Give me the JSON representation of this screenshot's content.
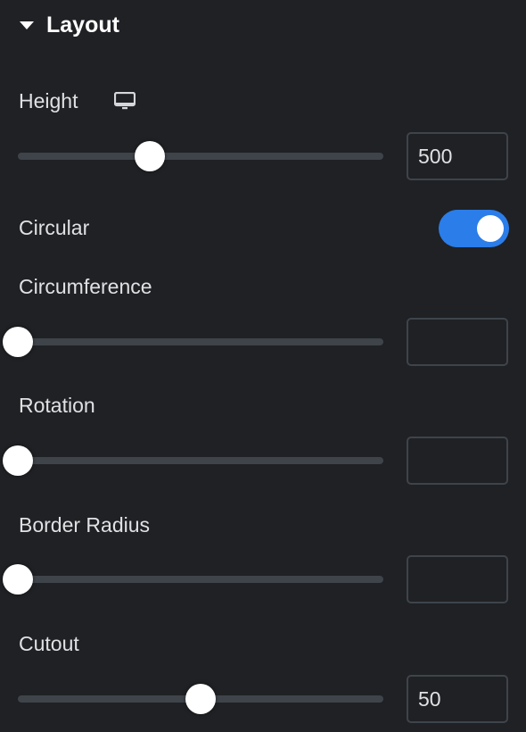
{
  "section": {
    "title": "Layout",
    "expanded": true
  },
  "controls": {
    "height": {
      "label": "Height",
      "value": "500",
      "fraction": 0.36,
      "device_icon": "desktop-monitor-icon"
    },
    "circular": {
      "label": "Circular",
      "enabled": true
    },
    "circumference": {
      "label": "Circumference",
      "value": "",
      "fraction": 0
    },
    "rotation": {
      "label": "Rotation",
      "value": "",
      "fraction": 0
    },
    "border_radius": {
      "label": "Border Radius",
      "value": "",
      "fraction": 0
    },
    "cutout": {
      "label": "Cutout",
      "value": "50",
      "fraction": 0.5
    }
  },
  "colors": {
    "background": "#1f2124",
    "accent": "#2b7de9",
    "track": "#3f444b",
    "text": "#e0e1e3"
  }
}
